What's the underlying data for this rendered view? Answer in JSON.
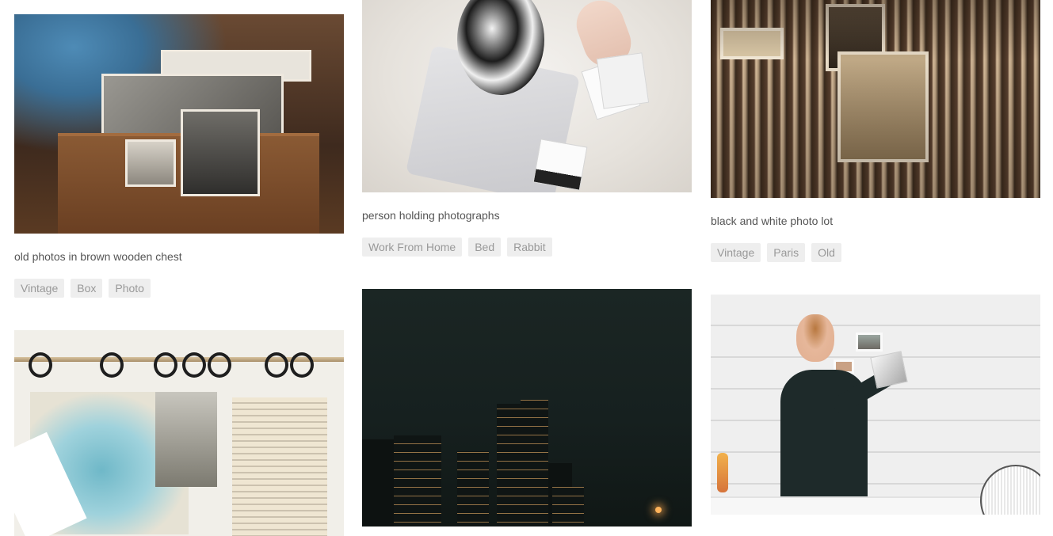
{
  "cards": [
    {
      "caption": "old photos in brown wooden chest",
      "tags": [
        "Vintage",
        "Box",
        "Photo"
      ]
    },
    {
      "caption": "person holding photographs",
      "tags": [
        "Work From Home",
        "Bed",
        "Rabbit"
      ]
    },
    {
      "caption": "black and white photo lot",
      "tags": [
        "Vintage",
        "Paris",
        "Old"
      ]
    },
    {
      "caption": "",
      "tags": []
    },
    {
      "caption": "",
      "tags": []
    },
    {
      "caption": "",
      "tags": []
    }
  ],
  "colors": {
    "caption_text": "#555555",
    "tag_background": "#eeeeee",
    "tag_text": "#999999",
    "page_background": "#ffffff"
  }
}
